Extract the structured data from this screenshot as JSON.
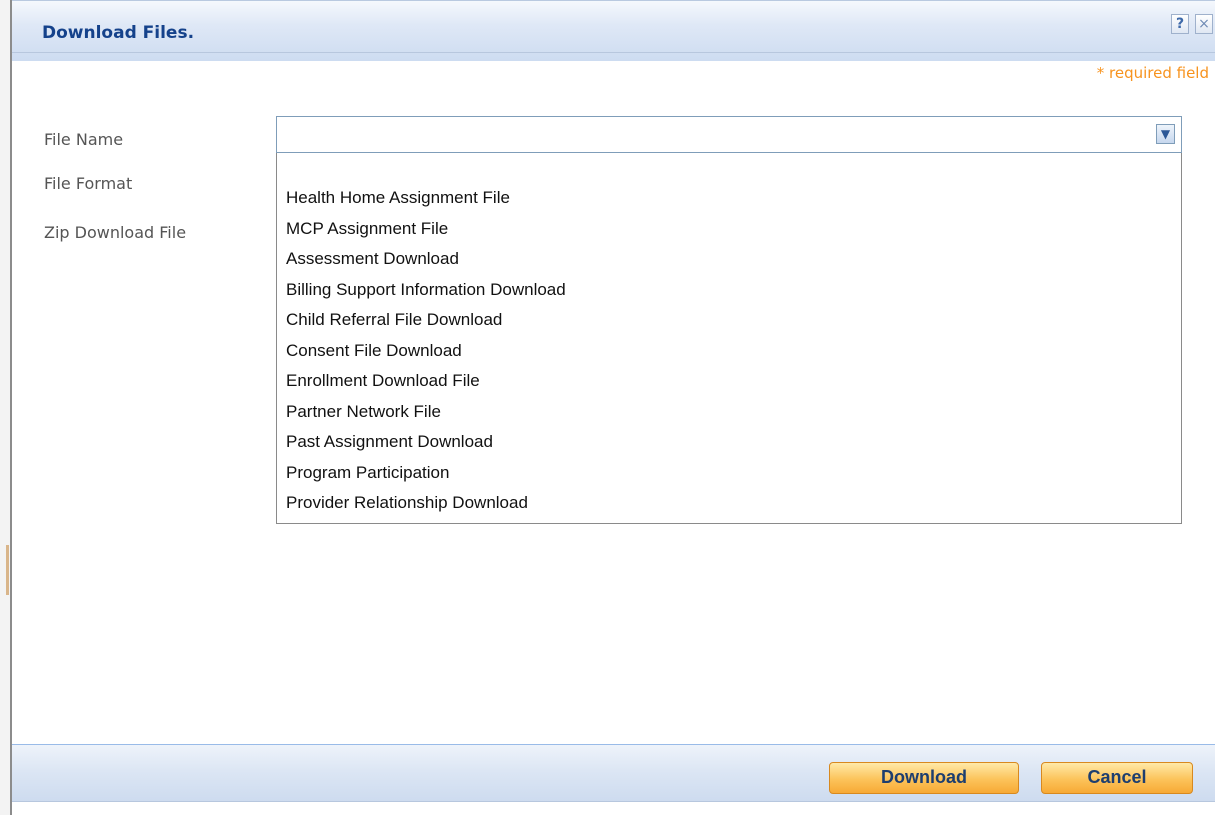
{
  "dialog": {
    "title": "Download Files.",
    "help_icon": "?",
    "close_icon": "×",
    "required_note": "* required field"
  },
  "form": {
    "file_name_label": "File Name",
    "file_format_label": "File Format",
    "zip_label": "Zip Download File",
    "file_name_value": "",
    "dropdown_arrow": "▼",
    "options": [
      "Health Home Assignment File",
      "MCP Assignment File",
      "Assessment Download",
      "Billing Support Information Download",
      "Child Referral File Download",
      "Consent File Download",
      "Enrollment Download File",
      "Partner Network File",
      "Past Assignment Download",
      "Program Participation",
      "Provider Relationship Download"
    ]
  },
  "footer": {
    "download_label": "Download",
    "cancel_label": "Cancel"
  },
  "colors": {
    "title_text": "#15428b",
    "required_text": "#f7931e",
    "button_fill": "#fcc35a",
    "header_band": "#dfe8f6"
  }
}
